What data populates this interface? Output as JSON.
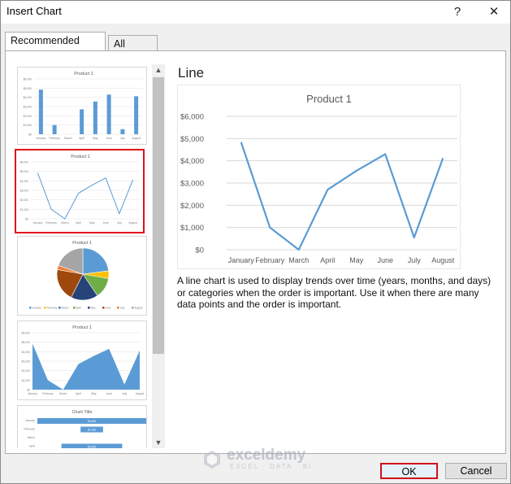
{
  "dialog": {
    "title": "Insert Chart",
    "help_label": "?",
    "close_label": "✕",
    "tabs": [
      {
        "label": "Recommended Charts",
        "active": true
      },
      {
        "label": "All Charts",
        "active": false
      }
    ],
    "preview_name": "Line",
    "description": "A line chart is used to display trends over time (years, months, and days) or categories when the order is important. Use it when there are many data points and the order is important.",
    "ok_label": "OK",
    "cancel_label": "Cancel",
    "watermark": {
      "name": "exceldemy",
      "tagline": "EXCEL · DATA · BI"
    }
  },
  "thumbnails": {
    "titles": [
      "Product 1",
      "Product 1",
      "Product 1",
      "Product 1",
      "Chart Title"
    ],
    "bar_labels": [
      "$4,839",
      "$1,000",
      "",
      "$2,699"
    ],
    "selected_index": 1
  },
  "colors": {
    "series": "#5b9bd5",
    "selection": "#e0101a",
    "pie": [
      "#5b9bd5",
      "#ffc000",
      "#4472c4",
      "#70ad47",
      "#264478",
      "#9e480e",
      "#ed7d31",
      "#a5a5a5"
    ]
  },
  "chart_data": {
    "type": "line",
    "title": "Product 1",
    "categories": [
      "January",
      "February",
      "March",
      "April",
      "May",
      "June",
      "July",
      "August"
    ],
    "values": [
      4839,
      1000,
      0,
      2699,
      3550,
      4300,
      550,
      4120
    ],
    "ylim": [
      0,
      6000
    ],
    "yticks": [
      "$0",
      "$1,000",
      "$2,000",
      "$3,000",
      "$4,000",
      "$5,000",
      "$6,000"
    ],
    "xlabel": "",
    "ylabel": "",
    "grid": true,
    "legend": "none"
  }
}
